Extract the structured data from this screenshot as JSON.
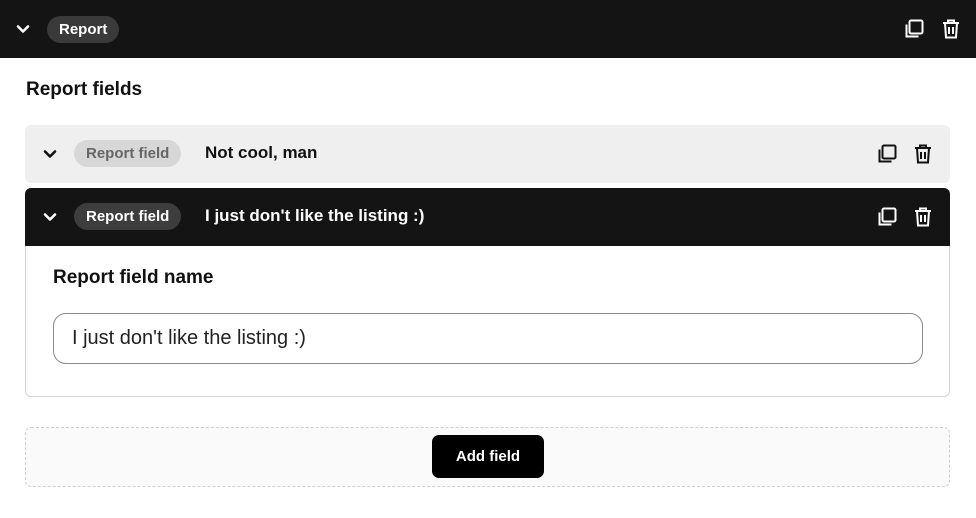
{
  "report": {
    "badge": "Report",
    "icons": {
      "toggle": "chevron-down-icon",
      "duplicate": "duplicate-icon",
      "delete": "trash-icon"
    }
  },
  "fields_section": {
    "title": "Report fields",
    "items": [
      {
        "badge": "Report field",
        "title": "Not cool, man",
        "state": "collapsed"
      },
      {
        "badge": "Report field",
        "title": "I just don't like the listing :)",
        "state": "expanded"
      }
    ]
  },
  "editor": {
    "label": "Report field name",
    "value": "I just don't like the listing :)"
  },
  "add_field": {
    "label": "Add field"
  },
  "colors": {
    "header_bg": "#141414",
    "collapsed_row_bg": "#efefef",
    "accent_button": "#000000"
  }
}
